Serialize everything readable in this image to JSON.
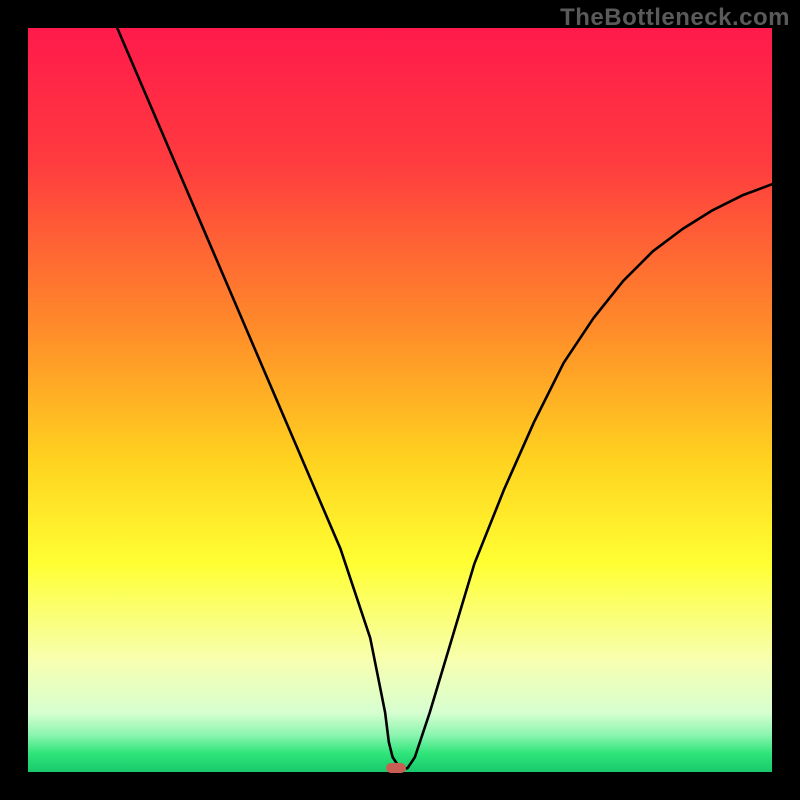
{
  "watermark": "TheBottleneck.com",
  "chart_data": {
    "type": "line",
    "title": "",
    "xlabel": "",
    "ylabel": "",
    "xlim": [
      0,
      100
    ],
    "ylim": [
      0,
      100
    ],
    "gradient_stops": [
      {
        "offset": 0.0,
        "color": "#ff1a4b"
      },
      {
        "offset": 0.18,
        "color": "#ff3b3f"
      },
      {
        "offset": 0.4,
        "color": "#ff8a2a"
      },
      {
        "offset": 0.58,
        "color": "#ffd21f"
      },
      {
        "offset": 0.72,
        "color": "#ffff33"
      },
      {
        "offset": 0.85,
        "color": "#f7ffb0"
      },
      {
        "offset": 0.92,
        "color": "#d7ffd0"
      },
      {
        "offset": 0.95,
        "color": "#8cf5b0"
      },
      {
        "offset": 0.975,
        "color": "#2fe57a"
      },
      {
        "offset": 1.0,
        "color": "#18c96b"
      }
    ],
    "series": [
      {
        "name": "bottleneck-curve",
        "x": [
          12,
          15,
          18,
          21,
          24,
          27,
          30,
          33,
          36,
          39,
          42,
          44,
          46,
          47,
          48,
          48.5,
          49,
          50,
          51,
          52,
          54,
          57,
          60,
          64,
          68,
          72,
          76,
          80,
          84,
          88,
          92,
          96,
          100
        ],
        "y": [
          100,
          93,
          86,
          79,
          72,
          65,
          58,
          51,
          44,
          37,
          30,
          24,
          18,
          13,
          8,
          4,
          2,
          0.5,
          0.5,
          2,
          8,
          18,
          28,
          38,
          47,
          55,
          61,
          66,
          70,
          73,
          75.5,
          77.5,
          79
        ]
      }
    ],
    "marker": {
      "x": 49.5,
      "y": 0.5,
      "color": "#c95f54"
    }
  }
}
